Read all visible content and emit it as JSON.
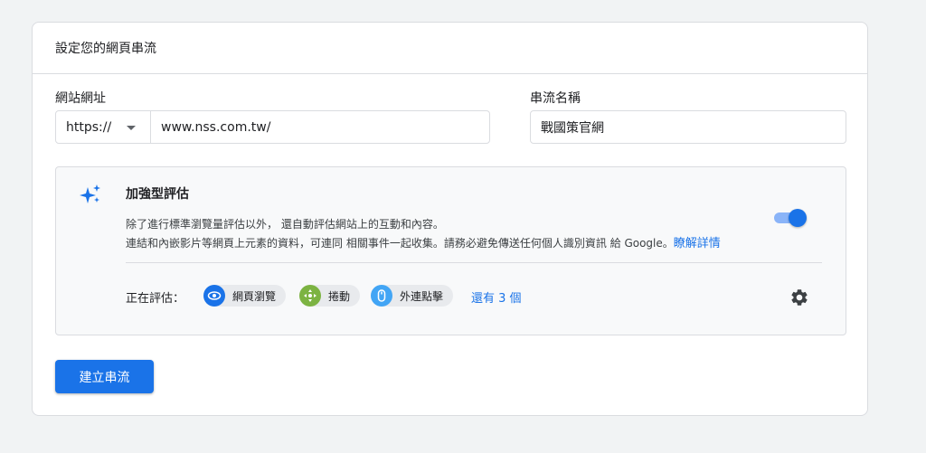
{
  "card": {
    "title": "設定您的網頁串流"
  },
  "website_url": {
    "label": "網站網址",
    "protocol": "https://",
    "value": "www.nss.com.tw/"
  },
  "stream_name": {
    "label": "串流名稱",
    "value": "戰國策官網"
  },
  "enhanced_measurement": {
    "title": "加強型評估",
    "description_line1": "除了進行標準瀏覽量評估以外， 還自動評估網站上的互動和內容。",
    "description_line2": "連結和內嵌影片等網頁上元素的資料，可連同 相關事件一起收集。請務必避免傳送任何個人識別資訊 給 Google。",
    "learn_more": "瞭解詳情",
    "enabled": true,
    "measuring_label": "正在評估：",
    "chips": [
      {
        "label": "網頁瀏覽",
        "icon": "eye-icon",
        "color": "#1a73e8"
      },
      {
        "label": "捲動",
        "icon": "scroll-icon",
        "color": "#7cb342"
      },
      {
        "label": "外連點擊",
        "icon": "mouse-icon",
        "color": "#42a5f5"
      }
    ],
    "more": "還有 3 個"
  },
  "create_button": "建立串流",
  "colors": {
    "primary": "#1a73e8",
    "border": "#dadce0",
    "background": "#f1f3f4"
  }
}
